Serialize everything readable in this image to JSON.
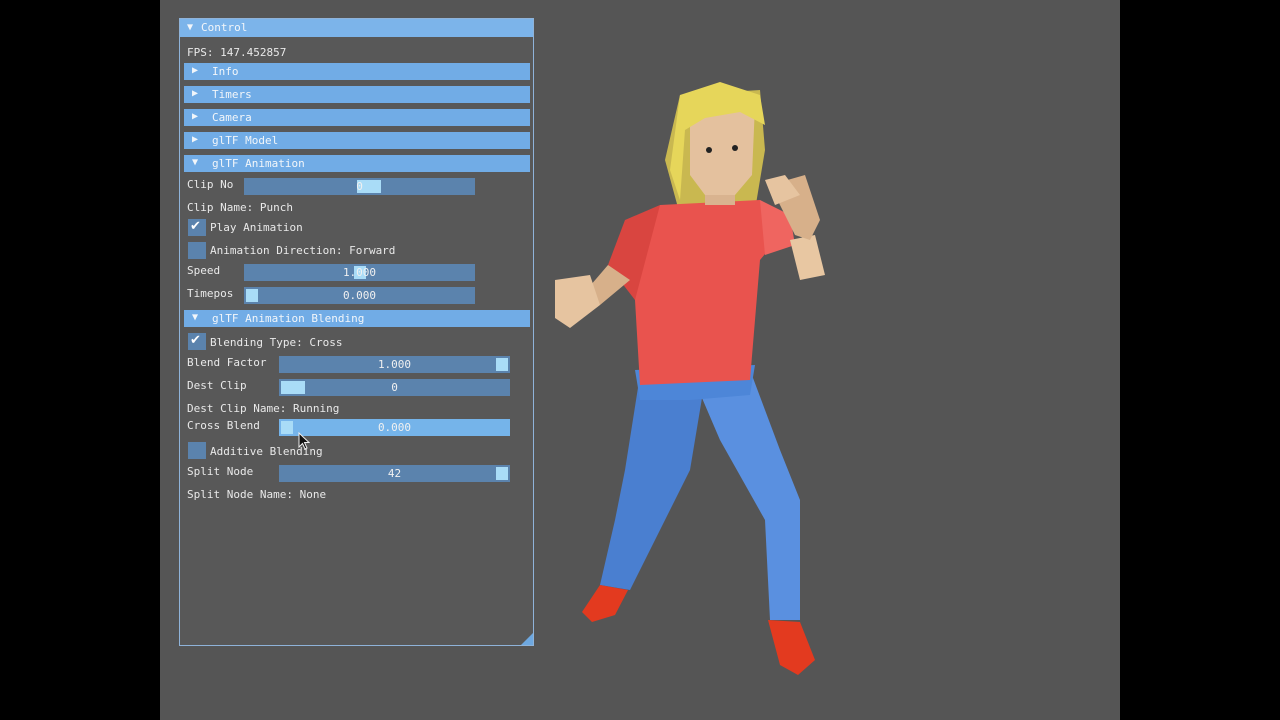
{
  "window": {
    "title": "Control",
    "fps": "FPS: 147.452857",
    "sections": {
      "info": "Info",
      "timers": "Timers",
      "camera": "Camera",
      "model": "glTF Model",
      "animation": "glTF Animation",
      "blending": "glTF Animation Blending"
    },
    "animation": {
      "clip_no_label": "Clip No",
      "clip_no_value": "0",
      "clip_name": "Clip Name: Punch",
      "play_animation": "Play Animation",
      "play_checked": true,
      "direction": "Animation Direction: Forward",
      "direction_checked": false,
      "speed_label": "Speed",
      "speed_value": "1.000",
      "timepos_label": "Timepos",
      "timepos_value": "0.000"
    },
    "blending": {
      "type": "Blending Type: Cross",
      "type_checked": true,
      "blend_factor_label": "Blend Factor",
      "blend_factor_value": "1.000",
      "dest_clip_label": "Dest Clip",
      "dest_clip_value": "0",
      "dest_clip_name": "Dest Clip Name: Running",
      "cross_blend_label": "Cross Blend",
      "cross_blend_value": "0.000",
      "additive": "Additive Blending",
      "additive_checked": false,
      "split_node_label": "Split Node",
      "split_node_value": "42",
      "split_node_name": "Split Node Name: None"
    },
    "icons": {
      "collapsed": "triangle-right-icon",
      "expanded": "triangle-down-icon",
      "check": "checkmark-icon"
    }
  },
  "colors": {
    "viewport_bg": "#555555",
    "panel_bg": "#585858",
    "header": "#71ace6",
    "frame": "#5b83ad",
    "grab": "#a9dcf7"
  }
}
